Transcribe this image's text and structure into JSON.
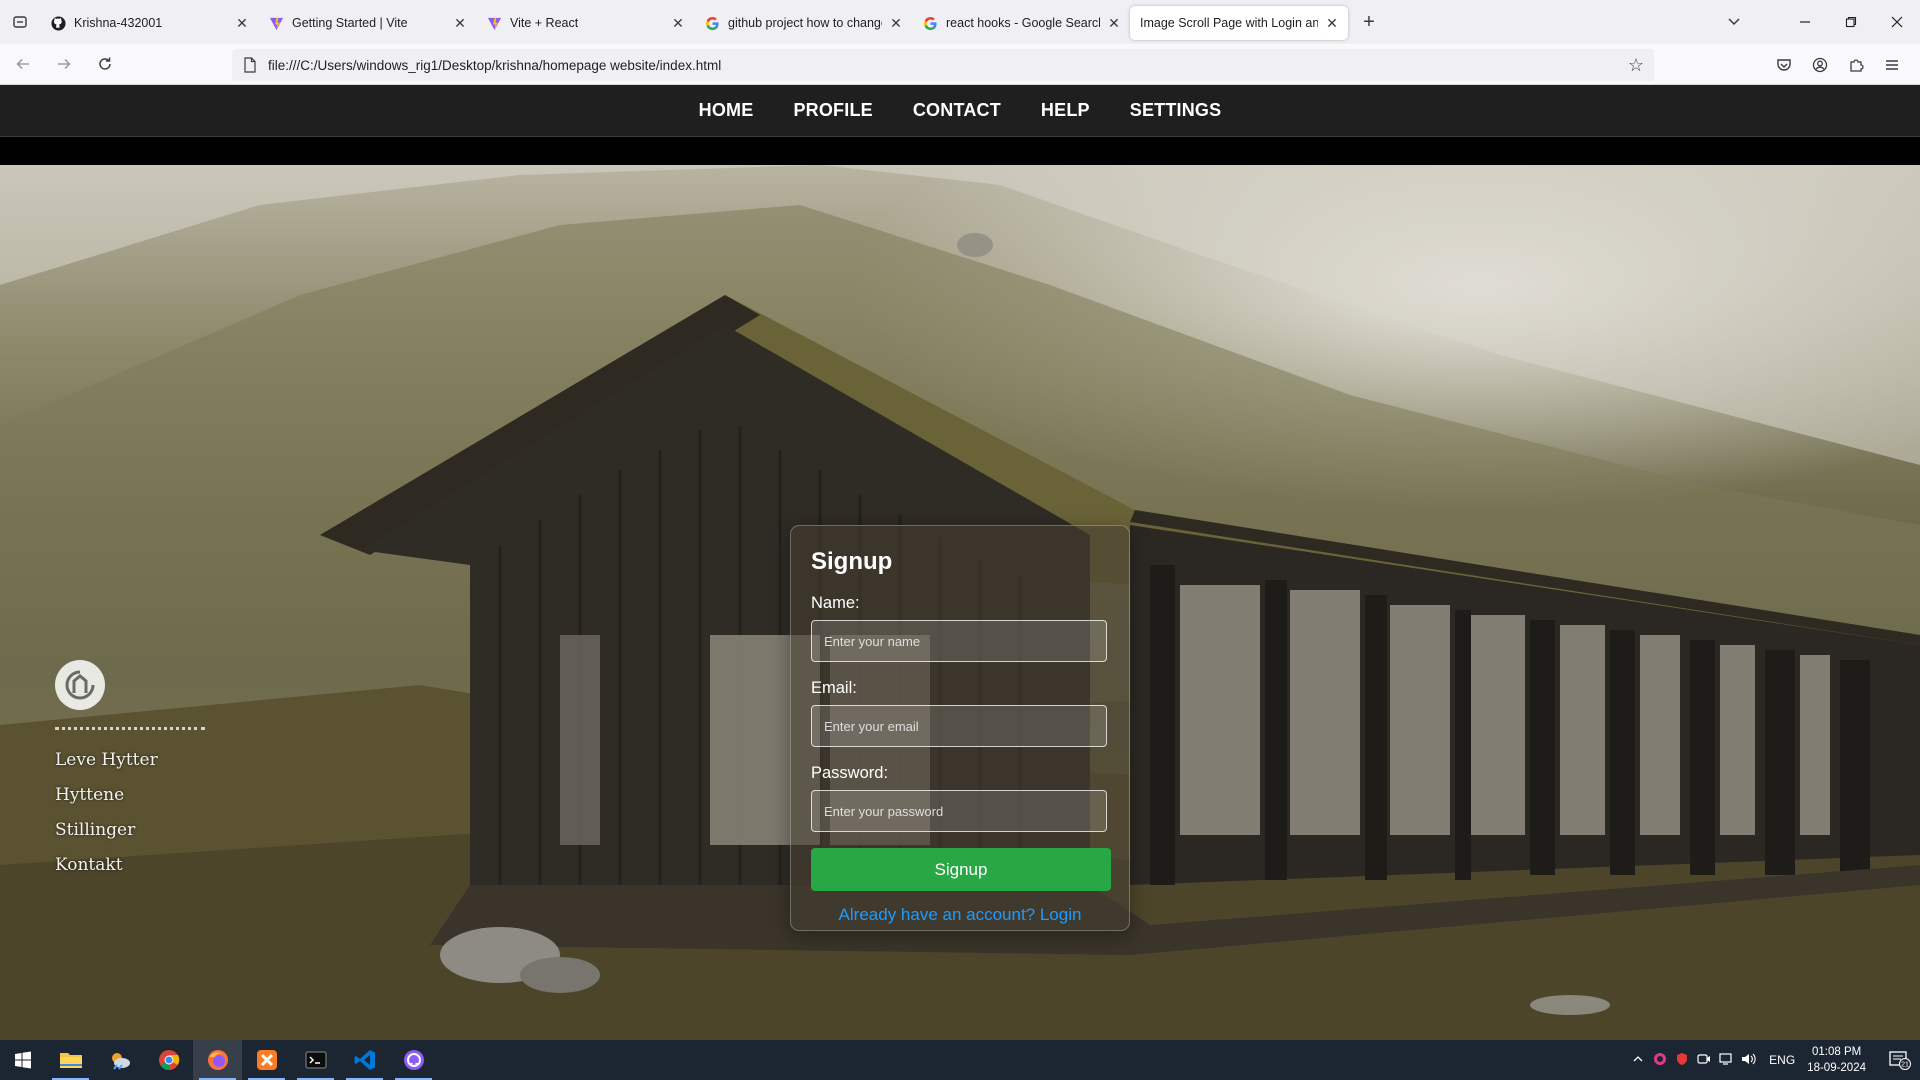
{
  "browser": {
    "tabs": [
      {
        "title": "Krishna-432001",
        "icon": "github-icon",
        "active": false
      },
      {
        "title": "Getting Started | Vite",
        "icon": "vite-icon",
        "active": false
      },
      {
        "title": "Vite + React",
        "icon": "vite-icon",
        "active": false
      },
      {
        "title": "github project how to change p",
        "icon": "google-icon",
        "active": false
      },
      {
        "title": "react hooks - Google Search",
        "icon": "google-icon",
        "active": false
      },
      {
        "title": "Image Scroll Page with Login and Si",
        "icon": "page-icon",
        "active": true
      }
    ],
    "url": "file:///C:/Users/windows_rig1/Desktop/krishna/homepage website/index.html"
  },
  "site_nav": {
    "items": [
      "HOME",
      "PROFILE",
      "CONTACT",
      "HELP",
      "SETTINGS"
    ]
  },
  "hero": {
    "menu": [
      "Leve Hytter",
      "Hyttene",
      "Stillinger",
      "Kontakt"
    ]
  },
  "signup": {
    "title": "Signup",
    "name_label": "Name:",
    "name_placeholder": "Enter your name",
    "email_label": "Email:",
    "email_placeholder": "Enter your email",
    "password_label": "Password:",
    "password_placeholder": "Enter your password",
    "button_label": "Signup",
    "login_link": "Already have an account? Login"
  },
  "taskbar": {
    "lang": "ENG",
    "time": "01:08 PM",
    "date": "18-09-2024",
    "notification_count": "21"
  },
  "colors": {
    "signup_button": "#28a745",
    "login_link": "#1e9bff",
    "site_nav_bg": "#1f1f1f"
  }
}
